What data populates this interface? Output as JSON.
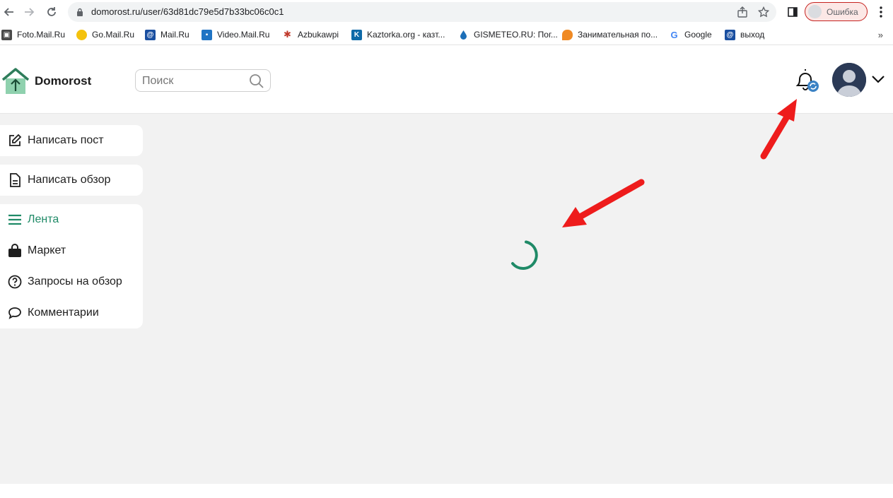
{
  "browser": {
    "url": "domorost.ru/user/63d81dc79e5d7b33bc06c0c1",
    "profile_label": "Ошибка",
    "bookmarks": [
      {
        "label": "Foto.Mail.Ru",
        "icon": "camera-icon"
      },
      {
        "label": "Go.Mail.Ru",
        "icon": "search-icon"
      },
      {
        "label": "Mail.Ru",
        "icon": "mail-at-icon"
      },
      {
        "label": "Video.Mail.Ru",
        "icon": "video-icon"
      },
      {
        "label": "Azbukawpi",
        "icon": "azbuka-icon"
      },
      {
        "label": "Kaztorka.org - казт...",
        "icon": "k-icon"
      },
      {
        "label": "GISMETEO.RU: Пог...",
        "icon": "drop-icon"
      },
      {
        "label": "Занимательная по...",
        "icon": "chat-icon"
      },
      {
        "label": "Google",
        "icon": "google-icon"
      },
      {
        "label": "выход",
        "icon": "mail-at-icon"
      }
    ],
    "bookmarks_more": "»"
  },
  "header": {
    "brand": "Domorost",
    "search_placeholder": "Поиск"
  },
  "sidebar": {
    "write_post": "Написать пост",
    "write_review": "Написать обзор",
    "nav": [
      {
        "label": "Лента",
        "icon": "menu-lines-icon",
        "active": true
      },
      {
        "label": "Маркет",
        "icon": "shopping-bag-icon",
        "active": false
      },
      {
        "label": "Запросы на обзор",
        "icon": "question-circle-icon",
        "active": false
      },
      {
        "label": "Комментарии",
        "icon": "comment-icon",
        "active": false
      }
    ]
  },
  "colors": {
    "accent": "#1f8a67",
    "logo_roof": "#2e7d5b",
    "logo_body": "#8fd1ae",
    "annotation_arrow": "#ee1c1c",
    "notification_badge": "#3b82c4",
    "content_bg": "#f2f2f2"
  },
  "status": {
    "loading": true
  }
}
